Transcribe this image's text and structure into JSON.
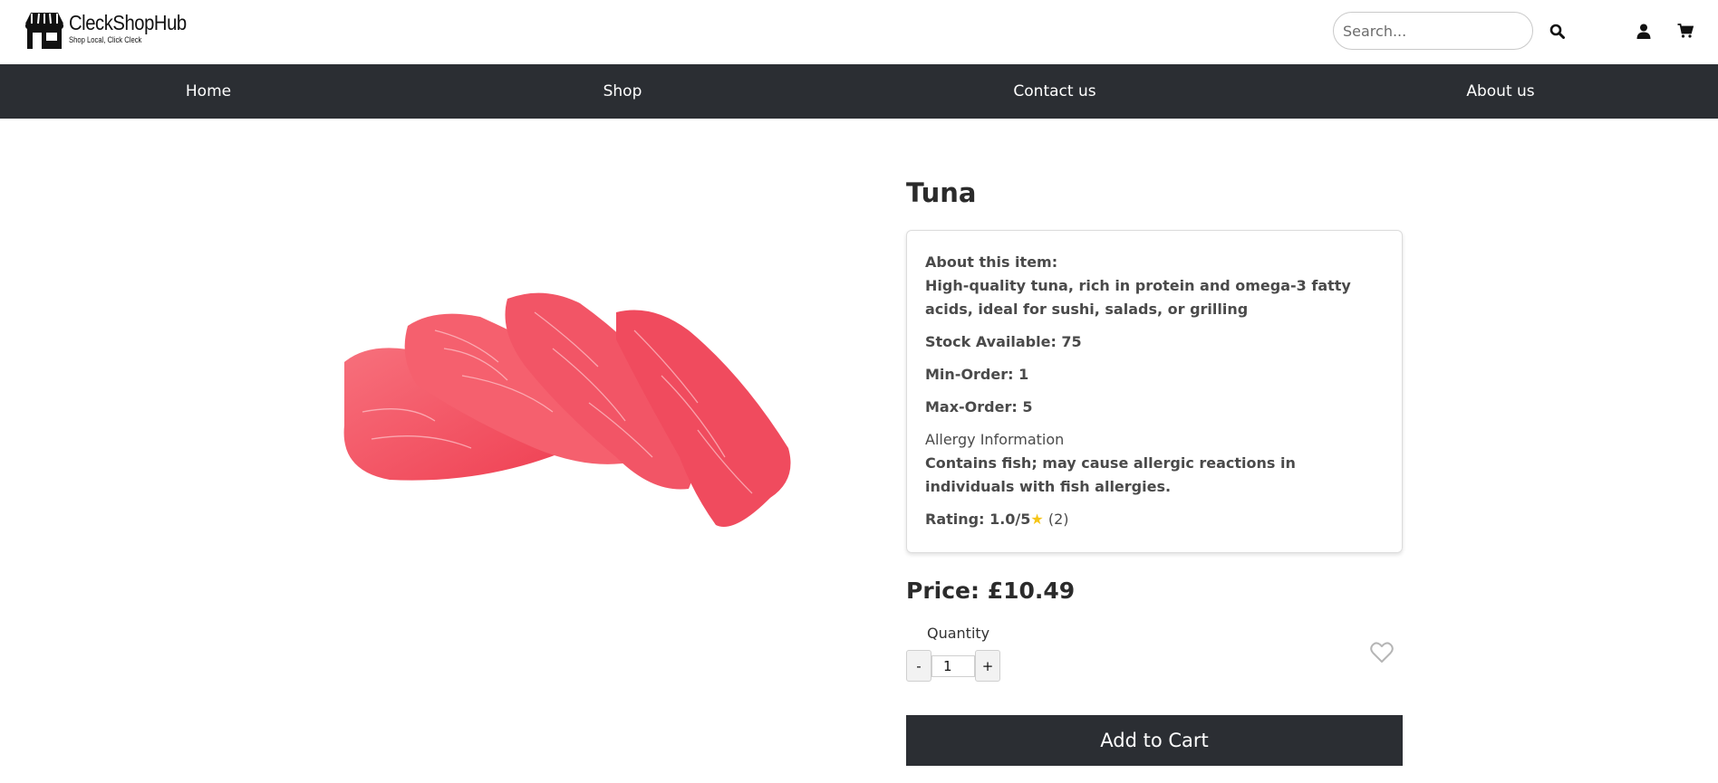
{
  "brand": {
    "name": "CleckShopHub",
    "tagline": "Shop Local, Click Cleck"
  },
  "header": {
    "search_placeholder": "Search...",
    "icons": [
      "search-icon",
      "user-icon",
      "cart-icon"
    ]
  },
  "nav": {
    "items": [
      {
        "label": "Home"
      },
      {
        "label": "Shop"
      },
      {
        "label": "Contact us"
      },
      {
        "label": "About us"
      }
    ]
  },
  "product": {
    "name": "Tuna",
    "about_label": "About this item:",
    "description": "High-quality tuna, rich in protein and omega-3 fatty acids, ideal for sushi, salads, or grilling",
    "stock": "Stock Available: 75",
    "min_order": "Min-Order: 1",
    "max_order": "Max-Order: 5",
    "allergy_label": "Allergy Information",
    "allergy_text": "Contains fish; may cause allergic reactions in individuals with fish allergies.",
    "rating_prefix": "Rating: 1.0/5",
    "rating_star": "★",
    "rating_count": " (2)",
    "price": "Price: £10.49",
    "quantity_label": "Quantity",
    "quantity_value": "1",
    "minus_label": "-",
    "plus_label": "+",
    "add_to_cart_label": "Add to Cart"
  },
  "colors": {
    "nav_bg": "#2b2e33",
    "star": "#f5c518",
    "fish": "#f4505e"
  }
}
